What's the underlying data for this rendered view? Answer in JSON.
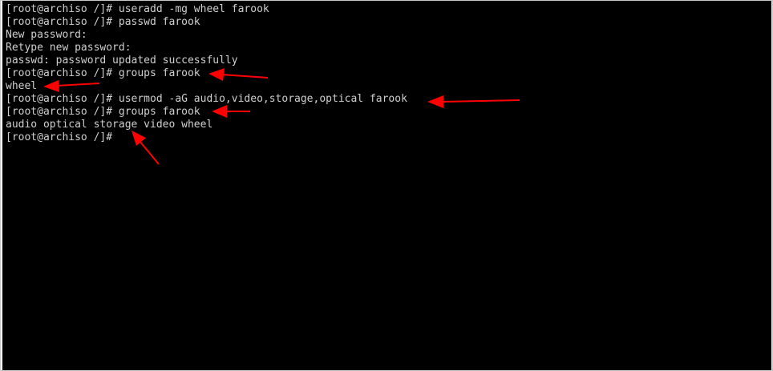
{
  "terminal": {
    "lines": [
      "[root@archiso /]# useradd -mg wheel farook",
      "[root@archiso /]# passwd farook",
      "New password:",
      "Retype new password:",
      "passwd: password updated successfully",
      "[root@archiso /]# groups farook",
      "wheel",
      "[root@archiso /]# usermod -aG audio,video,storage,optical farook",
      "[root@archiso /]# groups farook",
      "audio optical storage video wheel",
      "[root@archiso /]#"
    ]
  },
  "annotations": {
    "arrow_color": "#ff0000",
    "icon": "red-arrow-icon"
  },
  "colors": {
    "background": "#000000",
    "text": "#cfcfcf",
    "border": "#c9c9c9"
  }
}
